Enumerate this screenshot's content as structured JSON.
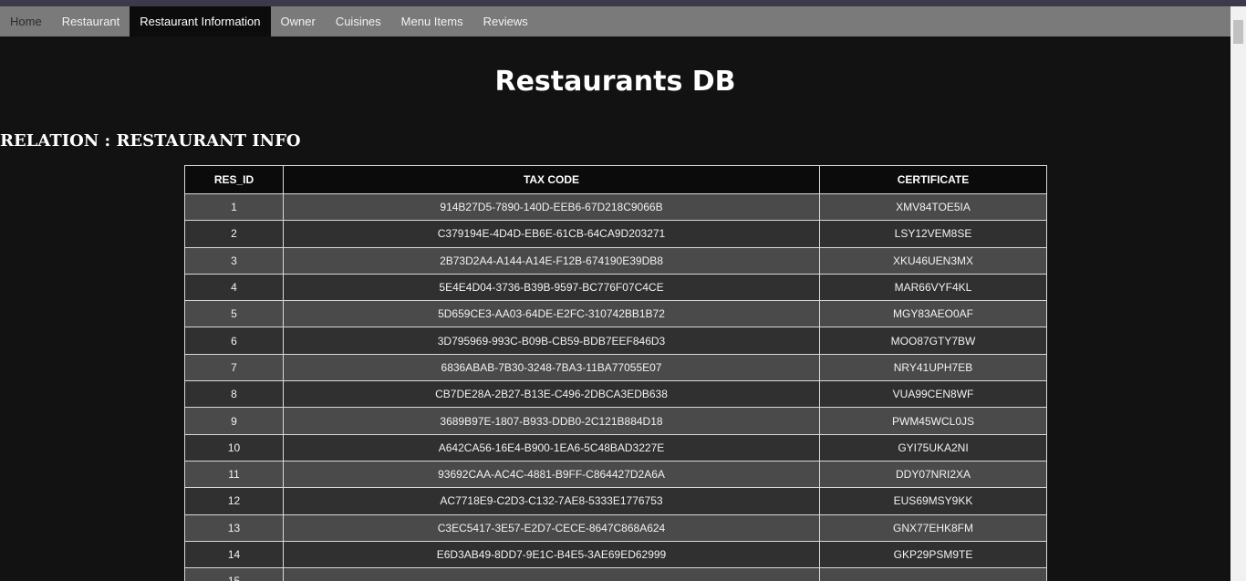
{
  "nav": {
    "items": [
      {
        "label": "Home"
      },
      {
        "label": "Restaurant"
      },
      {
        "label": "Restaurant Information"
      },
      {
        "label": "Owner"
      },
      {
        "label": "Cuisines"
      },
      {
        "label": "Menu Items"
      },
      {
        "label": "Reviews"
      }
    ],
    "active_index": 2
  },
  "page": {
    "title": "Restaurants DB",
    "relation_heading": "RELATION : RESTAURANT INFO"
  },
  "table": {
    "headers": [
      "RES_ID",
      "TAX CODE",
      "CERTIFICATE"
    ],
    "rows": [
      [
        "1",
        "914B27D5-7890-140D-EEB6-67D218C9066B",
        "XMV84TOE5IA"
      ],
      [
        "2",
        "C379194E-4D4D-EB6E-61CB-64CA9D203271",
        "LSY12VEM8SE"
      ],
      [
        "3",
        "2B73D2A4-A144-A14E-F12B-674190E39DB8",
        "XKU46UEN3MX"
      ],
      [
        "4",
        "5E4E4D04-3736-B39B-9597-BC776F07C4CE",
        "MAR66VYF4KL"
      ],
      [
        "5",
        "5D659CE3-AA03-64DE-E2FC-310742BB1B72",
        "MGY83AEO0AF"
      ],
      [
        "6",
        "3D795969-993C-B09B-CB59-BDB7EEF846D3",
        "MOO87GTY7BW"
      ],
      [
        "7",
        "6836ABAB-7B30-3248-7BA3-11BA77055E07",
        "NRY41UPH7EB"
      ],
      [
        "8",
        "CB7DE28A-2B27-B13E-C496-2DBCA3EDB638",
        "VUA99CEN8WF"
      ],
      [
        "9",
        "3689B97E-1807-B933-DDB0-2C121B884D18",
        "PWM45WCL0JS"
      ],
      [
        "10",
        "A642CA56-16E4-B900-1EA6-5C48BAD3227E",
        "GYI75UKA2NI"
      ],
      [
        "11",
        "93692CAA-AC4C-4881-B9FF-C864427D2A6A",
        "DDY07NRI2XA"
      ],
      [
        "12",
        "AC7718E9-C2D3-C132-7AE8-5333E1776753",
        "EUS69MSY9KK"
      ],
      [
        "13",
        "C3EC5417-3E57-E2D7-CECE-8647C868A624",
        "GNX77EHK8FM"
      ],
      [
        "14",
        "E6D3AB49-8DD7-9E1C-B4E5-3AE69ED62999",
        "GKP29PSM9TE"
      ],
      [
        "15",
        "",
        ""
      ]
    ]
  }
}
